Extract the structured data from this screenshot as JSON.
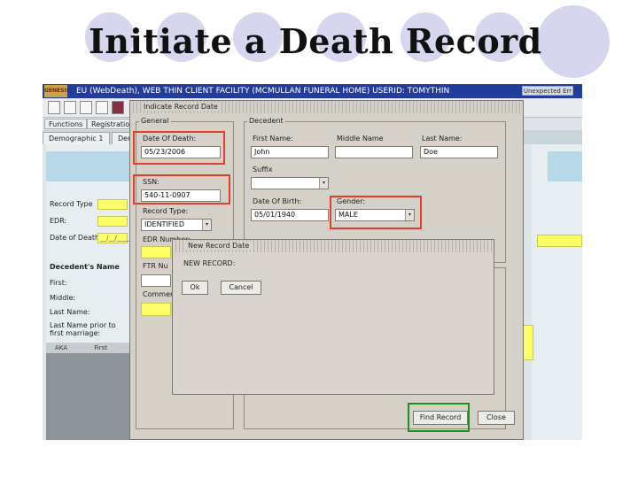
{
  "slide": {
    "title": "Initiate a Death Record"
  },
  "app": {
    "logo": "GENESIS",
    "window_title": "EU (WebDeath), WEB THIN CLIENT FACILITY (MCMULLAN FUNERAL HOME) USERID: TOMYTHIN",
    "unexpected_label": "Unexpected Err",
    "menu": [
      "Functions",
      "Registratio"
    ],
    "tabs": [
      "Demographic 1",
      "Der"
    ],
    "left_panel": {
      "record_type_label": "Record Type",
      "edr_label": "EDR:",
      "date_of_death_label": "Date of Death:",
      "date_placeholder": "__/__/____",
      "decedent_name_heading": "Decedent's Name",
      "first_label": "First:",
      "middle_label": "Middle:",
      "last_label": "Last Name:",
      "last_name_prior_label": "Last Name prior to first marriage:",
      "grid_headers": [
        "AKA",
        "First"
      ]
    }
  },
  "dialog_indicate": {
    "title": "Indicate Record Date",
    "general": {
      "group_label": "General",
      "date_of_death_label": "Date Of Death:",
      "date_of_death_value": "05/23/2006",
      "ssn_label": "SSN:",
      "ssn_value": "540-11-0907",
      "record_type_label": "Record Type:",
      "record_type_value": "IDENTIFIED",
      "edr_number_label": "EDR Number:",
      "ftr_label": "FTR Nu",
      "comments_label": "Comment"
    },
    "decedent": {
      "group_label": "Decedent",
      "first_name_label": "First Name:",
      "first_name_value": "John",
      "middle_name_label": "Middle Name",
      "middle_name_value": "",
      "last_name_label": "Last Name:",
      "last_name_value": "Doe",
      "suffix_label": "Suffix",
      "suffix_value": "",
      "dob_label": "Date Of Birth:",
      "dob_value": "05/01/1940",
      "gender_label": "Gender:",
      "gender_value": "MALE"
    },
    "find_record_label": "Find Record",
    "close_label": "Close"
  },
  "dialog_new": {
    "title": "New Record Date",
    "message": "NEW RECORD:",
    "ok_label": "Ok",
    "cancel_label": "Cancel"
  },
  "colors": {
    "highlight_red": "#e2402a",
    "highlight_green": "#1f8f1f",
    "title_bar": "#223c9c"
  }
}
